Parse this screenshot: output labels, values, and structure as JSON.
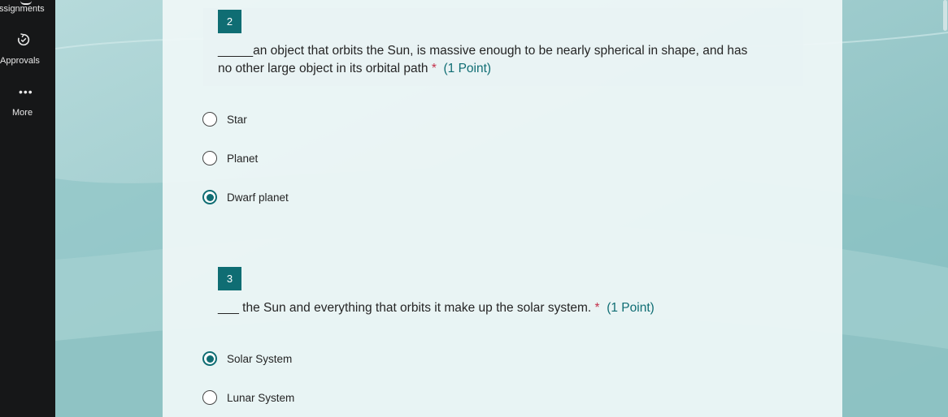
{
  "sidebar": {
    "assignments_label": "ssignments",
    "approvals_label": "Approvals",
    "more_dots": "•••",
    "more_label": "More"
  },
  "questions": [
    {
      "number": "2",
      "text_line1": "_____an object that orbits the Sun, is massive enough to be nearly spherical in shape, and has",
      "text_line2": "no other large object in its orbital path",
      "required": "*",
      "points": "(1 Point)",
      "options": [
        {
          "label": "Star",
          "selected": false
        },
        {
          "label": "Planet",
          "selected": false
        },
        {
          "label": "Dwarf planet",
          "selected": true
        }
      ]
    },
    {
      "number": "3",
      "text_line1": "___ the Sun and everything that orbits it make up the solar system.",
      "required": "*",
      "points": "(1 Point)",
      "options": [
        {
          "label": "Solar System",
          "selected": true
        },
        {
          "label": "Lunar System",
          "selected": false
        }
      ]
    }
  ],
  "colors": {
    "accent": "#0f6d73",
    "required": "#c4314b",
    "sidebar_bg": "#161718"
  }
}
